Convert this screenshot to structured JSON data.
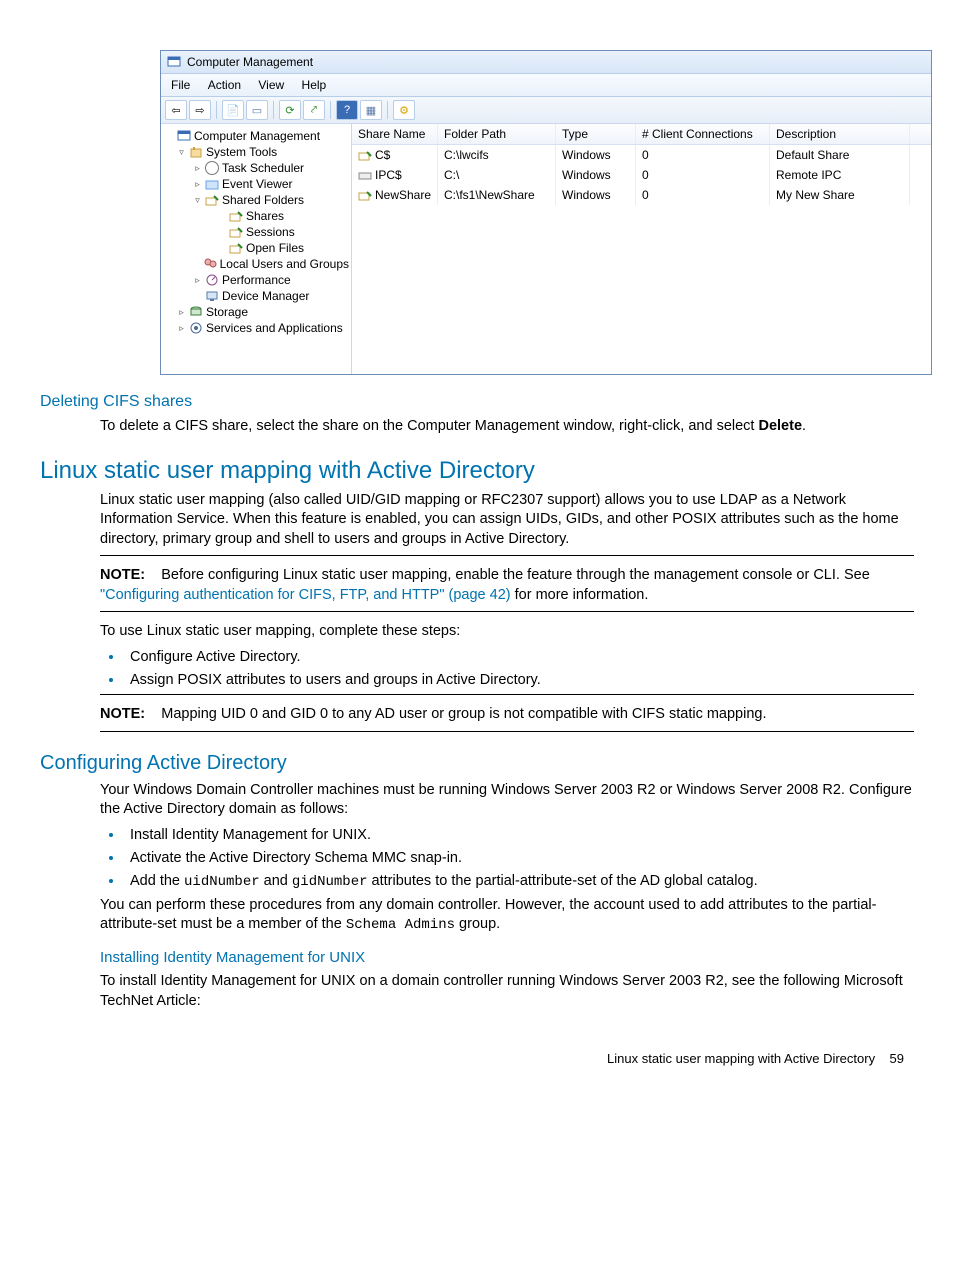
{
  "screenshot": {
    "title": "Computer Management",
    "menu": [
      "File",
      "Action",
      "View",
      "Help"
    ],
    "toolbar_icons": [
      "back-arrow-icon",
      "forward-arrow-icon",
      "|",
      "up-folder-icon",
      "properties-icon",
      "|",
      "refresh-icon",
      "export-icon",
      "|",
      "help-icon",
      "list-icon",
      "|",
      "extra-icon"
    ],
    "tree": [
      {
        "indent": 0,
        "caret": "",
        "icon": "compmgmt",
        "label": "Computer Management"
      },
      {
        "indent": 1,
        "caret": "▿",
        "icon": "systools",
        "label": "System Tools"
      },
      {
        "indent": 2,
        "caret": "▹",
        "icon": "clock",
        "label": "Task Scheduler"
      },
      {
        "indent": 2,
        "caret": "▹",
        "icon": "folder",
        "label": "Event Viewer"
      },
      {
        "indent": 2,
        "caret": "▿",
        "icon": "share",
        "label": "Shared Folders"
      },
      {
        "indent": 3,
        "caret": "",
        "icon": "share",
        "label": "Shares"
      },
      {
        "indent": 3,
        "caret": "",
        "icon": "share",
        "label": "Sessions"
      },
      {
        "indent": 3,
        "caret": "",
        "icon": "share",
        "label": "Open Files"
      },
      {
        "indent": 2,
        "caret": "",
        "icon": "users",
        "label": "Local Users and Groups"
      },
      {
        "indent": 2,
        "caret": "▹",
        "icon": "perf",
        "label": "Performance"
      },
      {
        "indent": 2,
        "caret": "",
        "icon": "device",
        "label": "Device Manager"
      },
      {
        "indent": 1,
        "caret": "▹",
        "icon": "storage",
        "label": "Storage"
      },
      {
        "indent": 1,
        "caret": "▹",
        "icon": "services",
        "label": "Services and Applications"
      }
    ],
    "columns": [
      "Share Name",
      "Folder Path",
      "Type",
      "# Client Connections",
      "Description"
    ],
    "rows": [
      {
        "icon": "share",
        "share": "C$",
        "folder": "C:\\lwcifs",
        "type": "Windows",
        "conn": "0",
        "desc": "Default Share"
      },
      {
        "icon": "pipe",
        "share": "IPC$",
        "folder": "C:\\",
        "type": "Windows",
        "conn": "0",
        "desc": "Remote IPC"
      },
      {
        "icon": "share",
        "share": "NewShare",
        "folder": "C:\\fs1\\NewShare",
        "type": "Windows",
        "conn": "0",
        "desc": "My New Share"
      }
    ]
  },
  "doc": {
    "h_deleting": "Deleting CIFS shares",
    "p_deleting_1a": "To delete a CIFS share, select the share on the Computer Management window, right-click, and select ",
    "p_deleting_1b": "Delete",
    "p_deleting_1c": ".",
    "h_linux": "Linux static user mapping with Active Directory",
    "p_linux_1": "Linux static user mapping (also called UID/GID mapping or RFC2307 support) allows you to use LDAP as a Network Information Service. When this feature is enabled, you can assign UIDs, GIDs, and other POSIX attributes such as the home directory, primary group and shell to users and groups in Active Directory.",
    "note_label": "NOTE:",
    "p_linux_note_a": "Before configuring Linux static user mapping, enable the feature through the management console or CLI. See ",
    "p_linux_note_link": "\"Configuring authentication for CIFS, FTP, and HTTP\" (page 42)",
    "p_linux_note_b": " for more information.",
    "p_linux_2": "To use Linux static user mapping, complete these steps:",
    "linux_steps": [
      "Configure Active Directory.",
      "Assign POSIX attributes to users and groups in Active Directory."
    ],
    "p_linux_note2": "Mapping UID 0 and GID 0 to any AD user or group is not compatible with CIFS static mapping.",
    "h_confad": "Configuring Active Directory",
    "p_confad_1": "Your Windows Domain Controller machines must be running Windows Server 2003 R2 or Windows Server 2008 R2. Configure the Active Directory domain as follows:",
    "confad_li1": "Install Identity Management for UNIX.",
    "confad_li2": "Activate the Active Directory Schema MMC snap-in.",
    "confad_li3_a": "Add the ",
    "confad_li3_code1": "uidNumber",
    "confad_li3_b": " and ",
    "confad_li3_code2": "gidNumber",
    "confad_li3_c": " attributes to the partial-attribute-set of the AD global catalog.",
    "p_confad_2a": "You can perform these procedures from any domain controller. However, the account used to add attributes to the partial-attribute-set must be a member of the ",
    "p_confad_2code": "Schema Admins",
    "p_confad_2b": " group.",
    "h_install": "Installing Identity Management for UNIX",
    "p_install_1": "To install Identity Management for UNIX on a domain controller running Windows Server 2003 R2, see the following Microsoft TechNet Article:",
    "footer_text": "Linux static user mapping with Active Directory",
    "footer_page": "59"
  }
}
